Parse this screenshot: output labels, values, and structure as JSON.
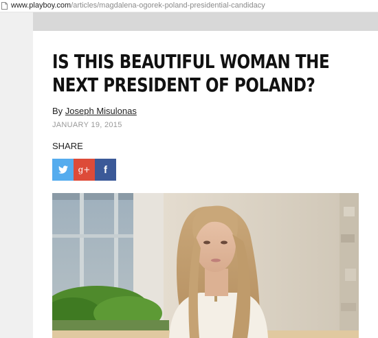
{
  "browser": {
    "url_host": "www.playboy.com",
    "url_path": "/articles/magdalena-ogorek-poland-presidential-candidacy"
  },
  "article": {
    "headline_line1": "IS THIS BEAUTIFUL WOMAN THE",
    "headline_line2": "NEXT PRESIDENT OF POLAND?",
    "byline_prefix": "By",
    "author": "Joseph Misulonas",
    "date": "JANUARY 19, 2015",
    "share_label": "SHARE"
  },
  "share_buttons": [
    {
      "network": "twitter",
      "icon": "twitter-icon",
      "color": "#55acee"
    },
    {
      "network": "google-plus",
      "icon": "google-plus-icon",
      "glyph": "g+",
      "color": "#dd4b39"
    },
    {
      "network": "facebook",
      "icon": "facebook-icon",
      "glyph": "f",
      "color": "#3b5998"
    }
  ],
  "hero_image": {
    "subject": "woman-portrait"
  }
}
